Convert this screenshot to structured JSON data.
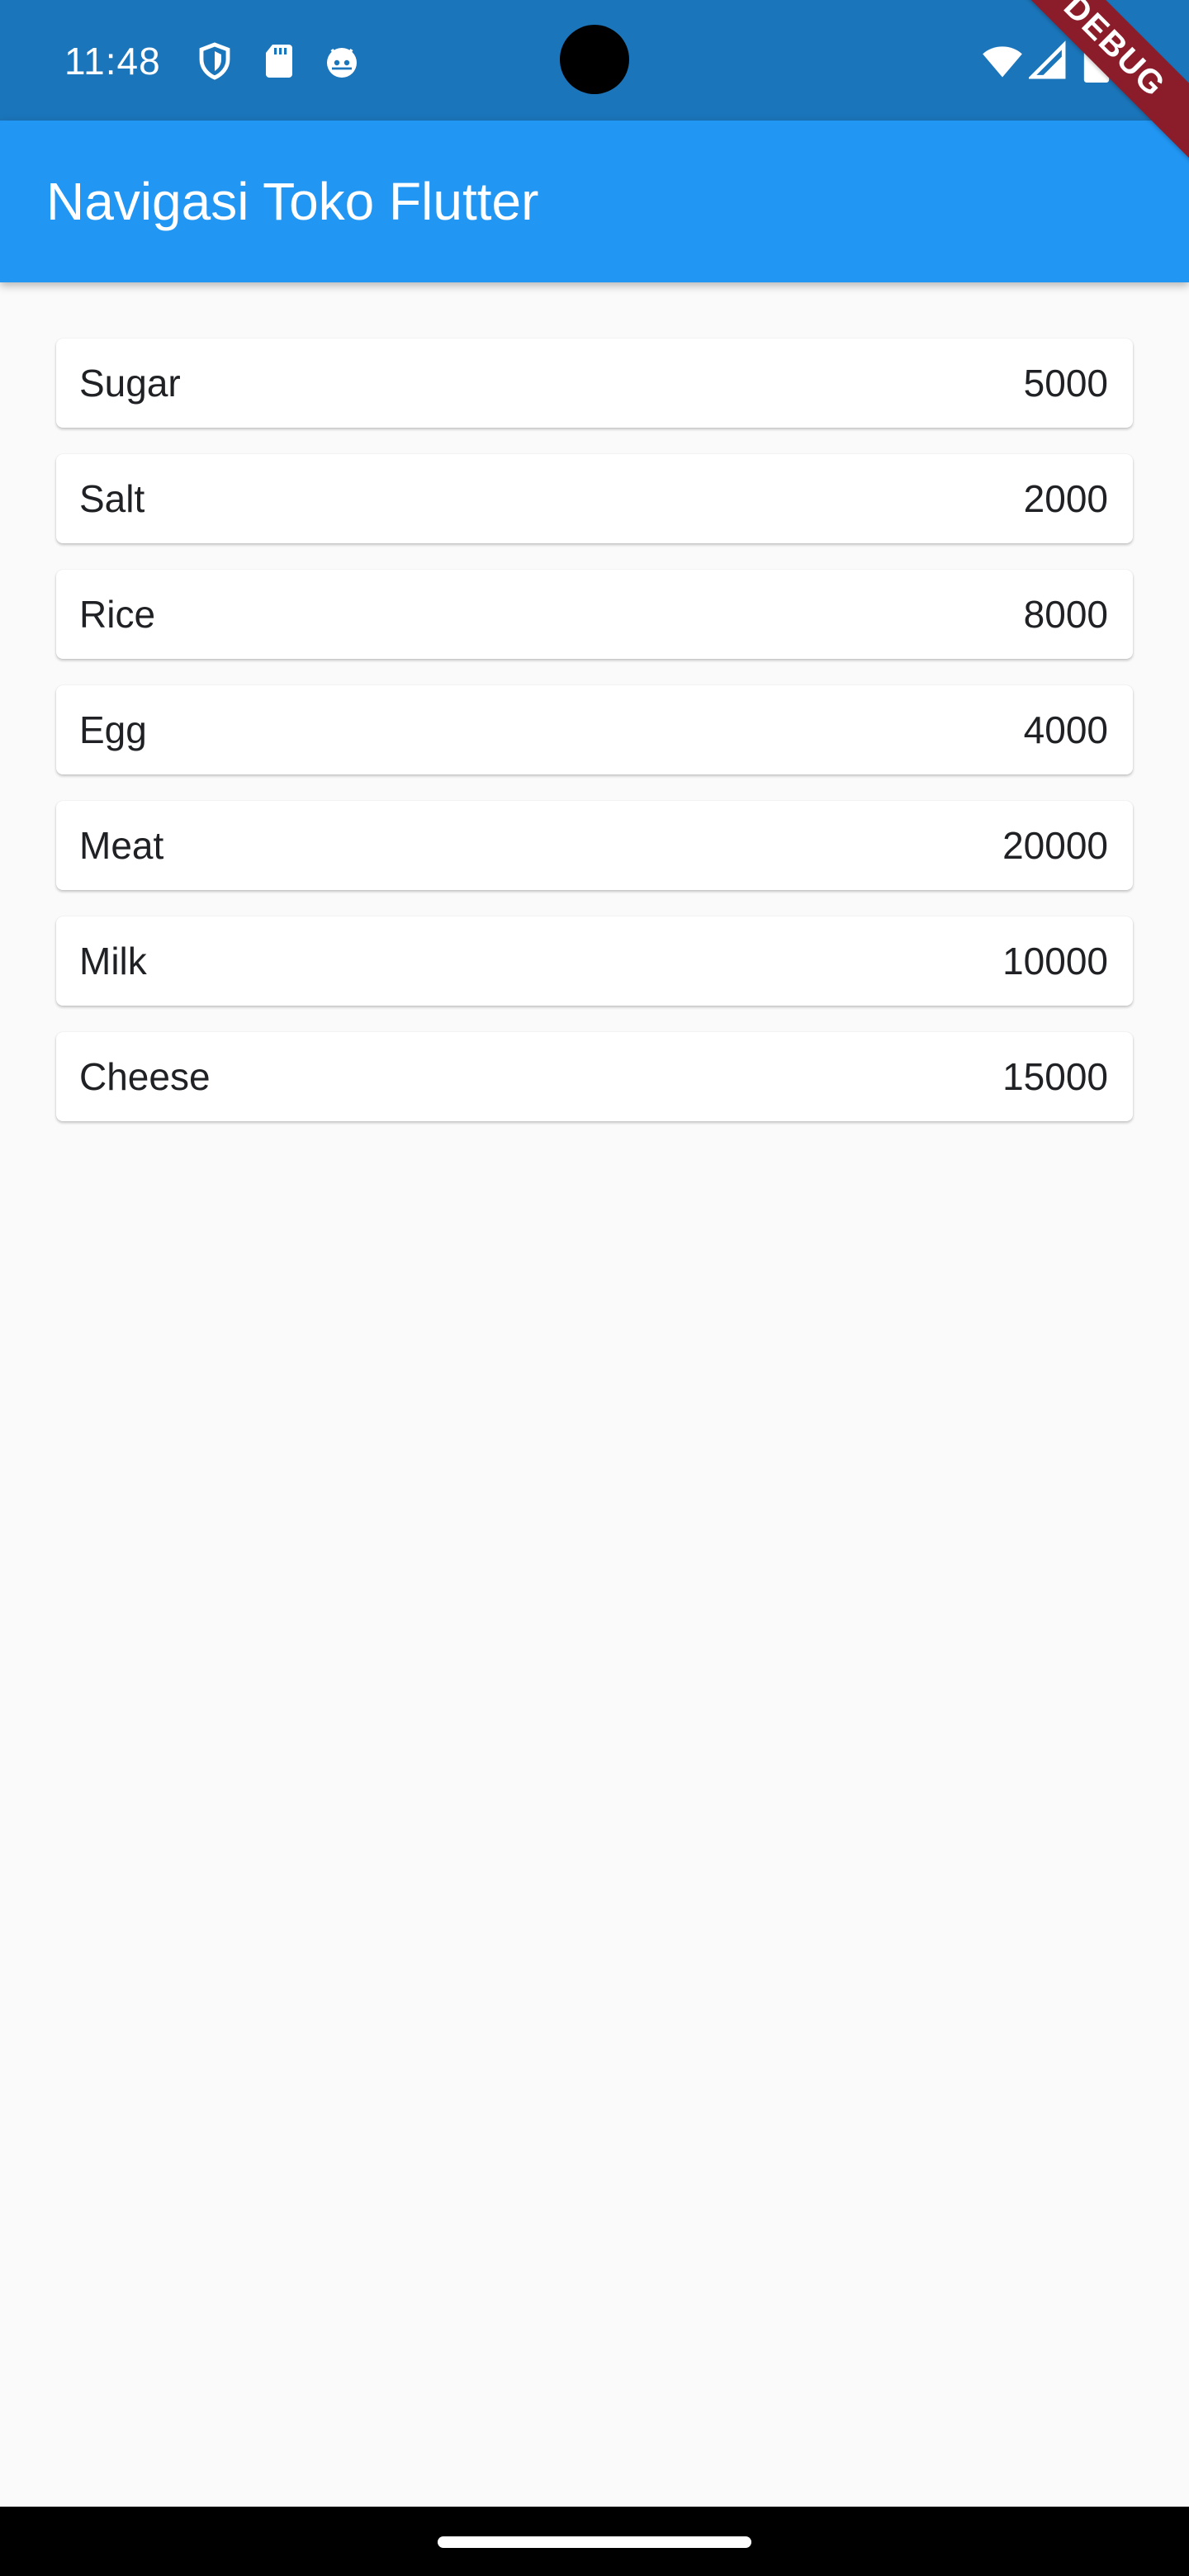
{
  "status_bar": {
    "time": "11:48",
    "left_icons": [
      "shield-icon",
      "sd-card-icon",
      "android-icon"
    ],
    "right_icons": [
      "wifi-icon",
      "cell-signal-icon",
      "battery-icon"
    ]
  },
  "debug_banner": "DEBUG",
  "app_bar": {
    "title": "Navigasi Toko Flutter"
  },
  "items": [
    {
      "name": "Sugar",
      "price": "5000"
    },
    {
      "name": "Salt",
      "price": "2000"
    },
    {
      "name": "Rice",
      "price": "8000"
    },
    {
      "name": "Egg",
      "price": "4000"
    },
    {
      "name": "Meat",
      "price": "20000"
    },
    {
      "name": "Milk",
      "price": "10000"
    },
    {
      "name": "Cheese",
      "price": "15000"
    }
  ],
  "colors": {
    "status_bar": "#1b75ba",
    "app_bar": "#2196f3",
    "background": "#fafafa",
    "debug_banner": "#8b1d2b"
  }
}
